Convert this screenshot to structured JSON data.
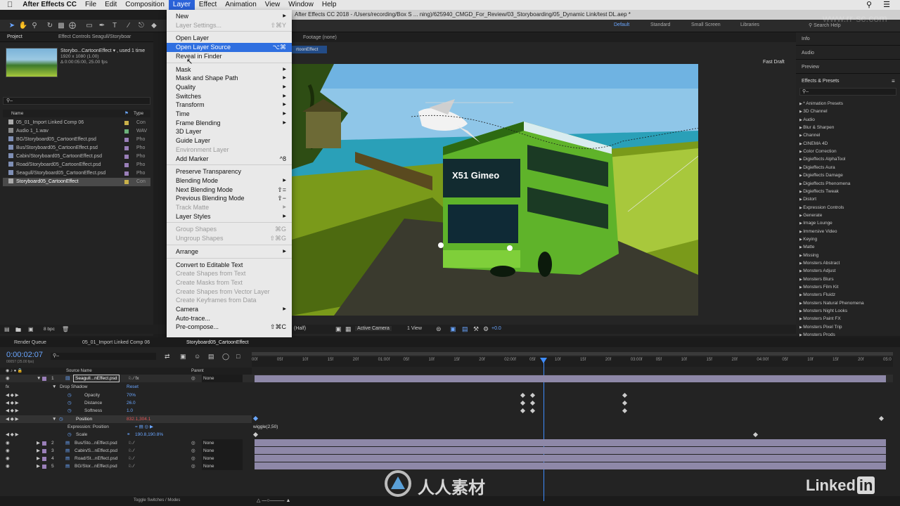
{
  "menubar": {
    "apple": "",
    "items": [
      "After Effects CC",
      "File",
      "Edit",
      "Composition",
      "Layer",
      "Effect",
      "Animation",
      "View",
      "Window",
      "Help"
    ],
    "active_index": 4
  },
  "titlebar": {
    "text": "After Effects CC 2018 - /Users/recording/Box S ... ning)/625940_CMGD_For_Review/03_Storyboarding/05_Dynamic Link/test DL.aep *"
  },
  "search_help": "Search Help",
  "workspaces": [
    "Default",
    "Standard",
    "Small Screen",
    "Libraries"
  ],
  "project_panel": {
    "tabs": [
      "Project",
      "Effect Controls Seagull/Storyboar"
    ],
    "selected_item": "Storybo...CartoonEffect ▾ , used 1 time",
    "selected_dims": "1920 x 1080 (1.00)",
    "selected_duration": "Δ 0:00:05:00, 25.00 fps",
    "col_name": "Name",
    "col_type": "Type",
    "items": [
      {
        "name": "05_01_Import Linked Comp 06",
        "type": "Con",
        "color": "#c9b14a"
      },
      {
        "name": "Audio 1_1.wav",
        "type": "WAV",
        "color": "#6cb27a"
      },
      {
        "name": "BG/Storyboard05_CartoonEffect.psd",
        "type": "Pho",
        "color": "#9a7fb9"
      },
      {
        "name": "Bus/Storyboard05_CartoonEffect.psd",
        "type": "Pho",
        "color": "#9a7fb9"
      },
      {
        "name": "Cabin/Storyboard05_CartoonEffect.psd",
        "type": "Pho",
        "color": "#9a7fb9"
      },
      {
        "name": "Road/Storyboard05_CartoonEffect.psd",
        "type": "Pho",
        "color": "#9a7fb9"
      },
      {
        "name": "Seagull/Storyboard05_CartoonEffect.psd",
        "type": "Pho",
        "color": "#9a7fb9"
      },
      {
        "name": "Storyboard05_CartoonEffect",
        "type": "Con",
        "color": "#c9b14a"
      }
    ],
    "bpc": "8 bpc"
  },
  "layer_menu": {
    "items": [
      {
        "label": "New",
        "arrow": true
      },
      {
        "label": "Layer Settings...",
        "shortcut": "⇧⌘Y",
        "disabled": true
      },
      {
        "sep": true
      },
      {
        "label": "Open Layer"
      },
      {
        "label": "Open Layer Source",
        "shortcut": "⌥⌘",
        "highlight": true
      },
      {
        "label": "Reveal in Finder"
      },
      {
        "sep": true
      },
      {
        "label": "Mask",
        "arrow": true
      },
      {
        "label": "Mask and Shape Path",
        "arrow": true
      },
      {
        "label": "Quality",
        "arrow": true
      },
      {
        "label": "Switches",
        "arrow": true
      },
      {
        "label": "Transform",
        "arrow": true
      },
      {
        "label": "Time",
        "arrow": true
      },
      {
        "label": "Frame Blending",
        "arrow": true
      },
      {
        "label": "3D Layer"
      },
      {
        "label": "Guide Layer"
      },
      {
        "label": "Environment Layer",
        "disabled": true
      },
      {
        "label": "Add Marker",
        "shortcut": "^8"
      },
      {
        "sep": true
      },
      {
        "label": "Preserve Transparency"
      },
      {
        "label": "Blending Mode",
        "arrow": true
      },
      {
        "label": "Next Blending Mode",
        "shortcut": "⇧="
      },
      {
        "label": "Previous Blending Mode",
        "shortcut": "⇧−"
      },
      {
        "label": "Track Matte",
        "arrow": true,
        "disabled": true
      },
      {
        "label": "Layer Styles",
        "arrow": true
      },
      {
        "sep": true
      },
      {
        "label": "Group Shapes",
        "shortcut": "⌘G",
        "disabled": true
      },
      {
        "label": "Ungroup Shapes",
        "shortcut": "⇧⌘G",
        "disabled": true
      },
      {
        "sep": true
      },
      {
        "label": "Arrange",
        "arrow": true
      },
      {
        "sep": true
      },
      {
        "label": "Convert to Editable Text"
      },
      {
        "label": "Create Shapes from Text",
        "disabled": true
      },
      {
        "label": "Create Masks from Text",
        "disabled": true
      },
      {
        "label": "Create Shapes from Vector Layer",
        "disabled": true
      },
      {
        "label": "Create Keyframes from Data",
        "disabled": true
      },
      {
        "label": "Camera",
        "arrow": true
      },
      {
        "label": "Auto-trace..."
      },
      {
        "label": "Pre-compose...",
        "shortcut": "⇧⌘C"
      }
    ]
  },
  "viewer": {
    "footage_label": "Footage (none)",
    "comp_tab": "rtoonEffect",
    "fast_draft": "Fast Draft",
    "resolution": "(Half)",
    "camera": "Active Camera",
    "views": "1 View",
    "exposure": "+0.0",
    "bus_sign": "X51 Gimeo"
  },
  "right_panel": {
    "headers": [
      "Info",
      "Audio",
      "Preview",
      "Effects & Presets"
    ],
    "effects": [
      "* Animation Presets",
      "3D Channel",
      "Audio",
      "Blur & Sharpen",
      "Channel",
      "CINEMA 4D",
      "Color Correction",
      "Digieffects AlphaTool",
      "Digieffects Aura",
      "Digieffects Damage",
      "Digieffects Phenomena",
      "Digieffects Tweak",
      "Distort",
      "Expression Controls",
      "Generate",
      "Image Lounge",
      "Immersive Video",
      "Keying",
      "Matte",
      "Missing",
      "Monsters Abstract",
      "Monsters Adjust",
      "Monsters Blurs",
      "Monsters Film Kit",
      "Monsters Fluidz",
      "Monsters Natural Phenomena",
      "Monsters Night Looks",
      "Monsters Paint FX",
      "Monsters Pixel Trip",
      "Monsters Prods"
    ]
  },
  "timeline": {
    "tabs": [
      "Render Queue",
      "05_01_Import Linked Comp 06",
      "Storyboard05_CartoonEffect"
    ],
    "timecode": "0:00:02:07",
    "timecode_sub": "00057 (25.00 fps)",
    "col_source": "Source Name",
    "col_parent": "Parent",
    "ruler_labels": [
      "00f",
      "05f",
      "10f",
      "15f",
      "20f",
      "01:00f",
      "05f",
      "10f",
      "15f",
      "20f",
      "02:00f",
      "05f",
      "10f",
      "15f",
      "20f",
      "03:00f",
      "05f",
      "10f",
      "15f",
      "20f",
      "04:00f",
      "05f",
      "10f",
      "15f",
      "20f",
      "05:0"
    ],
    "layer1": {
      "num": "1",
      "name": "Seagull...nEffect.psd",
      "parent": "None"
    },
    "drop_shadow": "Drop Shadow",
    "reset": "Reset",
    "props": [
      {
        "name": "Opacity",
        "value": "70%"
      },
      {
        "name": "Distance",
        "value": "26.0"
      },
      {
        "name": "Softness",
        "value": "1.0"
      }
    ],
    "position": {
      "name": "Position",
      "value": "832.1,304.1"
    },
    "expression_label": "Expression: Position",
    "expression_text": "wiggle(2,50)",
    "scale": {
      "name": "Scale",
      "value": "190.8,190.8%"
    },
    "other_layers": [
      {
        "num": "2",
        "name": "Bus/Sto...nEffect.psd",
        "parent": "None"
      },
      {
        "num": "3",
        "name": "Cabin/S...nEffect.psd",
        "parent": "None"
      },
      {
        "num": "4",
        "name": "Road/St...nEffect.psd",
        "parent": "None"
      },
      {
        "num": "5",
        "name": "BG/Stor...nEffect.psd",
        "parent": "None"
      }
    ],
    "footer": "Toggle Switches / Modes"
  },
  "watermark": {
    "brand": "人人素材",
    "site": "www.rr-sc.com"
  },
  "linkedin": {
    "text": "Linked",
    "in": "in"
  }
}
